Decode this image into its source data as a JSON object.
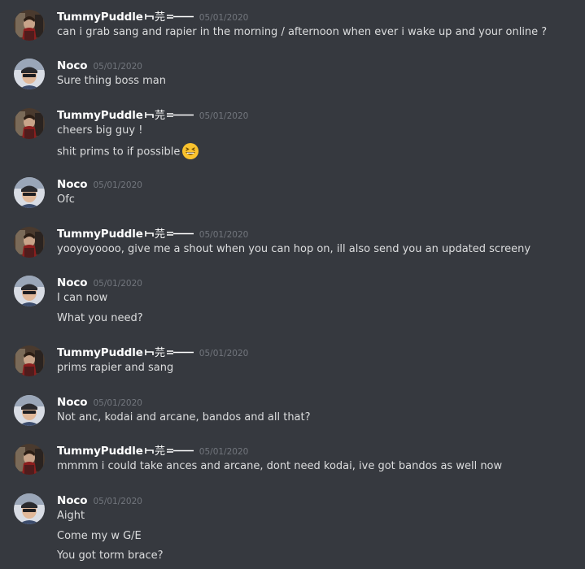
{
  "channel": {
    "messages": [
      {
        "author": "TummyPuddle",
        "author_decoration": "芫",
        "timestamp": "05/01/2020",
        "avatar_icon": "user-avatar-tummypuddle",
        "lines": [
          "can i grab sang and rapier in the morning / afternoon when ever i wake up and your online ?"
        ]
      },
      {
        "author": "Noco",
        "author_decoration": "",
        "timestamp": "05/01/2020",
        "avatar_icon": "user-avatar-noco",
        "lines": [
          "Sure thing boss man"
        ]
      },
      {
        "author": "TummyPuddle",
        "author_decoration": "芫",
        "timestamp": "05/01/2020",
        "avatar_icon": "user-avatar-tummypuddle",
        "lines": [
          "cheers big guy !",
          "shit prims to if possible"
        ],
        "emoji": "grinning-squinting-face-emoji"
      },
      {
        "author": "Noco",
        "author_decoration": "",
        "timestamp": "05/01/2020",
        "avatar_icon": "user-avatar-noco",
        "lines": [
          "Ofc"
        ]
      },
      {
        "author": "TummyPuddle",
        "author_decoration": "芫",
        "timestamp": "05/01/2020",
        "avatar_icon": "user-avatar-tummypuddle",
        "lines": [
          "yooyoyoooo, give me a shout when you can hop on, ill also send you an updated screeny"
        ]
      },
      {
        "author": "Noco",
        "author_decoration": "",
        "timestamp": "05/01/2020",
        "avatar_icon": "user-avatar-noco",
        "lines": [
          "I can now",
          "What you need?"
        ]
      },
      {
        "author": "TummyPuddle",
        "author_decoration": "芫",
        "timestamp": "05/01/2020",
        "avatar_icon": "user-avatar-tummypuddle",
        "lines": [
          "prims rapier and sang"
        ]
      },
      {
        "author": "Noco",
        "author_decoration": "",
        "timestamp": "05/01/2020",
        "avatar_icon": "user-avatar-noco",
        "lines": [
          "Not anc, kodai and arcane, bandos and all that?"
        ]
      },
      {
        "author": "TummyPuddle",
        "author_decoration": "芫",
        "timestamp": "05/01/2020",
        "avatar_icon": "user-avatar-tummypuddle",
        "lines": [
          "mmmm i could take ances and arcane, dont need kodai, ive got bandos as well now"
        ]
      },
      {
        "author": "Noco",
        "author_decoration": "",
        "timestamp": "05/01/2020",
        "avatar_icon": "user-avatar-noco",
        "lines": [
          "Aight",
          "Come my w G/E",
          "You got torm brace?"
        ]
      }
    ]
  },
  "colors": {
    "background": "#36393f",
    "username": "#ffffff",
    "timestamp": "#72767d",
    "message_text": "#dcddde"
  }
}
